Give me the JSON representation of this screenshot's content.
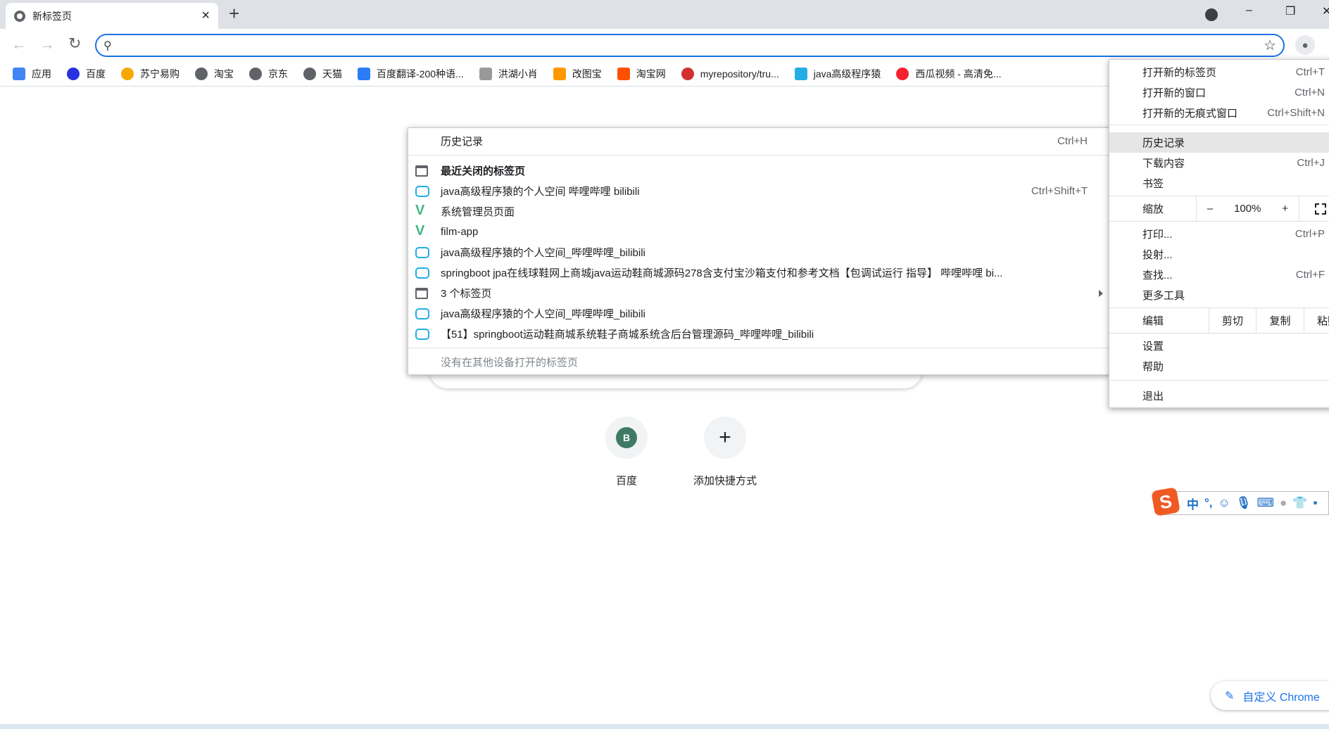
{
  "tab": {
    "title": "新标签页",
    "close": "×",
    "new_tab": "+"
  },
  "window": {
    "minimize": "–",
    "restore": "❐",
    "close": "✕"
  },
  "omnibox": {
    "value": "",
    "placeholder": ""
  },
  "bookmarks": [
    {
      "label": "应用",
      "icon": "apps-icon",
      "color": "#4285f4"
    },
    {
      "label": "百度",
      "icon": "baidu-icon",
      "color": "#2932e1"
    },
    {
      "label": "苏宁易购",
      "icon": "suning-icon",
      "color": "#f6a800"
    },
    {
      "label": "淘宝",
      "icon": "globe-icon",
      "color": "#5f6368"
    },
    {
      "label": "京东",
      "icon": "globe-icon",
      "color": "#5f6368"
    },
    {
      "label": "天猫",
      "icon": "globe-icon",
      "color": "#5f6368"
    },
    {
      "label": "百度翻译-200种语...",
      "icon": "translate-icon",
      "color": "#2b7cf6"
    },
    {
      "label": "洪湖小肖",
      "icon": "bird-icon",
      "color": "#999999"
    },
    {
      "label": "改图宝",
      "icon": "gaitubao-icon",
      "color": "#ff9800"
    },
    {
      "label": "淘宝网",
      "icon": "taobao-icon",
      "color": "#ff5000"
    },
    {
      "label": "myrepository/tru...",
      "icon": "repo-icon",
      "color": "#d32f2f"
    },
    {
      "label": "java高级程序猿",
      "icon": "bilibili-icon",
      "color": "#23ade5"
    },
    {
      "label": "西瓜视频 - 高清免...",
      "icon": "xigua-icon",
      "color": "#f5222d"
    }
  ],
  "history_menu": {
    "title": "历史记录",
    "title_shortcut": "Ctrl+H",
    "recent_header": "最近关闭的标签页",
    "items": [
      {
        "label": "java高级程序猿的个人空间 哔哩哔哩 bilibili",
        "icon": "bilibili-icon",
        "shortcut": "Ctrl+Shift+T"
      },
      {
        "label": "系统管理员页面",
        "icon": "vue-icon",
        "shortcut": ""
      },
      {
        "label": "film-app",
        "icon": "vue-icon",
        "shortcut": ""
      },
      {
        "label": "java高级程序猿的个人空间_哔哩哔哩_bilibili",
        "icon": "bilibili-icon",
        "shortcut": ""
      },
      {
        "label": "springboot jpa在线球鞋网上商城java运动鞋商城源码278含支付宝沙箱支付和参考文档【包调试运行 指导】 哔哩哔哩 bi...",
        "icon": "bilibili-icon",
        "shortcut": ""
      },
      {
        "label": "3 个标签页",
        "icon": "tab-icon",
        "shortcut": ""
      },
      {
        "label": "java高级程序猿的个人空间_哔哩哔哩_bilibili",
        "icon": "bilibili-icon",
        "shortcut": ""
      },
      {
        "label": "【51】springboot运动鞋商城系统鞋子商城系统含后台管理源码_哔哩哔哩_bilibili",
        "icon": "bilibili-icon",
        "shortcut": ""
      }
    ],
    "footer": "没有在其他设备打开的标签页"
  },
  "main_menu": {
    "new_tab": "打开新的标签页",
    "new_tab_sc": "Ctrl+T",
    "new_window": "打开新的窗口",
    "new_window_sc": "Ctrl+N",
    "incognito": "打开新的无痕式窗口",
    "incognito_sc": "Ctrl+Shift+N",
    "history": "历史记录",
    "downloads": "下载内容",
    "downloads_sc": "Ctrl+J",
    "bookmarks": "书签",
    "zoom": "缩放",
    "zoom_minus": "–",
    "zoom_value": "100%",
    "zoom_plus": "+",
    "print": "打印...",
    "print_sc": "Ctrl+P",
    "cast": "投射...",
    "find": "查找...",
    "find_sc": "Ctrl+F",
    "more_tools": "更多工具",
    "edit": "编辑",
    "cut": "剪切",
    "copy": "复制",
    "paste": "粘贴",
    "settings": "设置",
    "help": "帮助",
    "exit": "退出"
  },
  "shortcuts": [
    {
      "label": "百度",
      "letter": "B"
    },
    {
      "label": "添加快捷方式",
      "letter": "+"
    }
  ],
  "ime": {
    "logo": "S",
    "mode": "中",
    "punct": "°,"
  },
  "customize": {
    "label": "自定义 Chrome"
  }
}
